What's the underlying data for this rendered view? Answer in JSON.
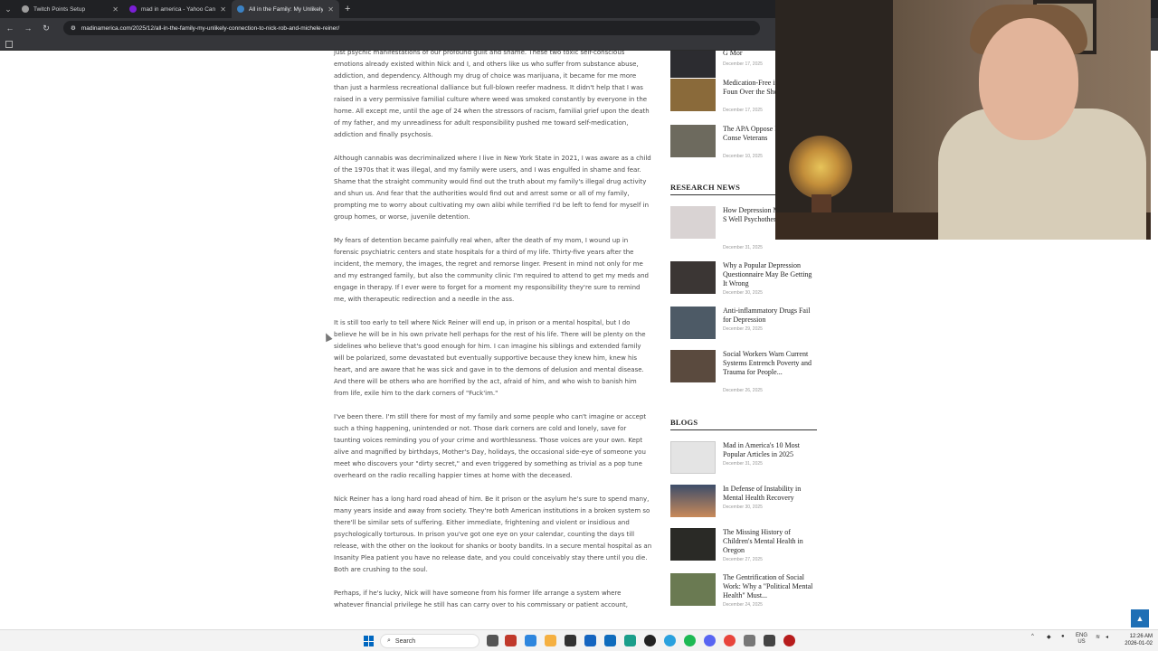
{
  "browser": {
    "tabs": [
      {
        "title": "Twitch Points Setup",
        "favicon_color": "#9e9e9e",
        "close": "✕"
      },
      {
        "title": "mad in america - Yahoo Canad",
        "favicon_color": "#7b1fd6",
        "close": "✕"
      },
      {
        "title": "All in the Family: My Unlikely Co",
        "favicon_color": "#3b82c4",
        "close": "✕"
      }
    ],
    "new_tab": "+",
    "url": "madinamerica.com/2025/12/all-in-the-family-my-unlikely-connection-to-nick-rob-and-michele-reiner/"
  },
  "article": {
    "paragraphs": [
      "just psychic manifestations of our profound guilt and shame. These two toxic self-conscious emotions already existed within Nick and I, and others like us who suffer from substance abuse, addiction, and dependency. Although my drug of choice was marijuana, it became for me more than just a harmless recreational dalliance but full-blown reefer madness. It didn't help that I was raised in a very permissive familial culture where weed was smoked constantly by everyone in the home. All except me, until the age of 24 when the stressors of racism, familial grief upon the death of my father, and my unreadiness for adult responsibility pushed me toward self-medication, addiction and finally psychosis.",
      "Although cannabis was decriminalized where I live in New York State in 2021, I was aware as a child of the 1970s that it was illegal, and my family were users, and I was engulfed in shame and fear. Shame that the straight community would find out the truth about my family's illegal drug activity and shun us. And fear that the authorities would find out and arrest some or all of my family, prompting me to worry about cultivating my own alibi while terrified I'd be left to fend for myself in group homes, or worse, juvenile detention.",
      "My fears of detention became painfully real when, after the death of my mom, I wound up in forensic psychiatric centers and state hospitals for a third of my life. Thirty-five years after the incident, the memory, the images, the regret and remorse linger. Present in mind not only for me and my estranged family, but also the community clinic I'm required to attend to get my meds and engage in therapy. If I ever were to forget for a moment my responsibility they're sure to remind me, with therapeutic redirection and a needle in the ass.",
      "It is still too early to tell where Nick Reiner will end up, in prison or a mental hospital, but I do believe he will be in his own private hell perhaps for the rest of his life. There will be plenty on the sidelines who believe that's good enough for him. I can imagine his siblings and extended family will be polarized, some devastated but eventually supportive because they knew him, knew his heart, and are aware that he was sick and gave in to the demons of delusion and mental disease. And there will be others who are horrified by the act, afraid of him, and who wish to banish him from life, exile him to the dark corners of \"Fuck'im.\"",
      "I've been there. I'm still there for most of my family and some people who can't imagine or accept such a thing happening, unintended or not. Those dark corners are cold and lonely, save for taunting voices reminding you of your crime and worthlessness. Those voices are your own. Kept alive and magnified by birthdays, Mother's Day, holidays, the occasional side-eye of someone you meet who discovers your \"dirty secret,\" and even triggered by something as trivial as a pop tune overheard on the radio recalling happier times at home with the deceased.",
      "Nick Reiner has a long hard road ahead of him. Be it prison or the asylum he's sure to spend many, many years inside and away from society. They're both American institutions in a broken system so there'll be similar sets of suffering. Either immediate, frightening and violent or insidious and psychologically torturous. In prison you've got one eye on your calendar, counting the days till release, with the other on the lookout for shanks or booty bandits. In a secure mental hospital as an Insanity Plea patient you have no release date, and you could conceivably stay there until you die. Both are crushing to the soul.",
      "Perhaps, if he's lucky, Nick will have someone from his former life arrange a system where whatever financial privilege he still has can carry over to his commissary or patient account,"
    ]
  },
  "sidebar": {
    "top_items": [
      {
        "title": "G Mor",
        "date": "December 17, 2025",
        "thumb": "#2c2c30"
      },
      {
        "title": "Medication-Free in Norway Foun Over the Short T",
        "date": "December 17, 2025",
        "thumb": "#8a6a3a"
      },
      {
        "title": "The APA Oppose Informed Conse Veterans",
        "date": "December 10, 2025",
        "thumb": "#6d6a5e"
      }
    ],
    "research_heading": "RESEARCH NEWS",
    "research_items": [
      {
        "title": "How Depression Measured May S Well Psychother to...",
        "date": "December 31, 2025",
        "thumb": "#d9d3d3"
      },
      {
        "title": "Why a Popular Depression Questionnaire May Be Getting It Wrong",
        "date": "December 30, 2025",
        "thumb": "#3b3634"
      },
      {
        "title": "Anti-inflammatory Drugs Fail for Depression",
        "date": "December 29, 2025",
        "thumb": "#4d5a66"
      },
      {
        "title": "Social Workers Warn Current Systems Entrench Poverty and Trauma for People...",
        "date": "December 26, 2025",
        "thumb": "#5a4a3e"
      }
    ],
    "blogs_heading": "BLOGS",
    "blog_items": [
      {
        "title": "Mad in America's 10 Most Popular Articles in 2025",
        "date": "December 31, 2025",
        "thumb": "#e4e4e4"
      },
      {
        "title": "In Defense of Instability in Mental Health Recovery",
        "date": "December 30, 2025",
        "thumb": "#3d4d6a"
      },
      {
        "title": "The Missing History of Children's Mental Health in Oregon",
        "date": "December 27, 2025",
        "thumb": "#2a2a26"
      },
      {
        "title": "The Gentrification of Social Work: Why a \"Political Mental Health\" Must...",
        "date": "December 24, 2025",
        "thumb": "#6a7a52"
      }
    ]
  },
  "taskbar": {
    "search_label": "Search",
    "lang_top": "ENG",
    "lang_bottom": "US",
    "time": "12:26 AM",
    "date": "2026-01-02"
  },
  "icons": {
    "back": "←",
    "forward": "→",
    "reload": "↻",
    "lock": "⚙",
    "back_to_top": "▲",
    "search": "⌕"
  }
}
